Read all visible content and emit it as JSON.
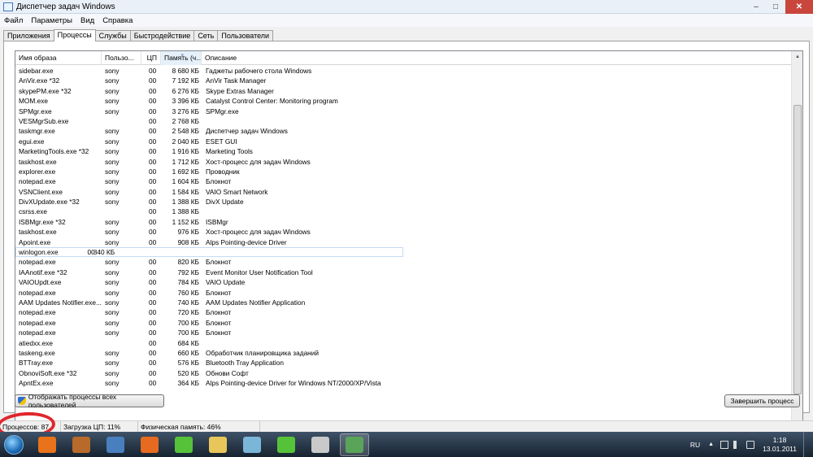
{
  "window": {
    "title": "Диспетчер задач Windows",
    "minimize": "–",
    "maximize": "□",
    "close": "✕"
  },
  "menu": [
    "Файл",
    "Параметры",
    "Вид",
    "Справка"
  ],
  "tabs": [
    {
      "label": "Приложения",
      "active": false
    },
    {
      "label": "Процессы",
      "active": true
    },
    {
      "label": "Службы",
      "active": false
    },
    {
      "label": "Быстродействие",
      "active": false
    },
    {
      "label": "Сеть",
      "active": false
    },
    {
      "label": "Пользователи",
      "active": false
    }
  ],
  "columns": [
    "Имя образа",
    "Пользо...",
    "ЦП",
    "Память (ч...",
    "Описание"
  ],
  "sorted_column_index": 3,
  "selected_row_index": 18,
  "processes": [
    [
      "sidebar.exe",
      "sony",
      "00",
      "8 680 КБ",
      "Гаджеты рабочего стола Windows"
    ],
    [
      "AnVir.exe *32",
      "sony",
      "00",
      "7 192 КБ",
      "AnVir Task Manager"
    ],
    [
      "skypePM.exe *32",
      "sony",
      "00",
      "6 276 КБ",
      "Skype Extras Manager"
    ],
    [
      "MOM.exe",
      "sony",
      "00",
      "3 396 КБ",
      "Catalyst Control Center: Monitoring program"
    ],
    [
      "SPMgr.exe",
      "sony",
      "00",
      "3 276 КБ",
      "SPMgr.exe"
    ],
    [
      "VESMgrSub.exe",
      "",
      "00",
      "2 768 КБ",
      ""
    ],
    [
      "taskmgr.exe",
      "sony",
      "00",
      "2 548 КБ",
      "Диспетчер задач Windows"
    ],
    [
      "egui.exe",
      "sony",
      "00",
      "2 040 КБ",
      "ESET GUI"
    ],
    [
      "MarketingTools.exe *32",
      "sony",
      "00",
      "1 916 КБ",
      "Marketing Tools"
    ],
    [
      "taskhost.exe",
      "sony",
      "00",
      "1 712 КБ",
      "Хост-процесс для задач Windows"
    ],
    [
      "explorer.exe",
      "sony",
      "00",
      "1 692 КБ",
      "Проводник"
    ],
    [
      "notepad.exe",
      "sony",
      "00",
      "1 604 КБ",
      "Блокнот"
    ],
    [
      "VSNClient.exe",
      "sony",
      "00",
      "1 584 КБ",
      "VAIO Smart Network"
    ],
    [
      "DivXUpdate.exe *32",
      "sony",
      "00",
      "1 388 КБ",
      "DivX Update"
    ],
    [
      "csrss.exe",
      "",
      "00",
      "1 388 КБ",
      ""
    ],
    [
      "ISBMgr.exe *32",
      "sony",
      "00",
      "1 152 КБ",
      "ISBMgr"
    ],
    [
      "taskhost.exe",
      "sony",
      "00",
      "976 КБ",
      "Хост-процесс для задач Windows"
    ],
    [
      "Apoint.exe",
      "sony",
      "00",
      "908 КБ",
      "Alps Pointing-device Driver"
    ],
    [
      "winlogon.exe",
      "",
      "00",
      "840 КБ",
      ""
    ],
    [
      "notepad.exe",
      "sony",
      "00",
      "820 КБ",
      "Блокнот"
    ],
    [
      "IAAnotif.exe *32",
      "sony",
      "00",
      "792 КБ",
      "Event Monitor User Notification Tool"
    ],
    [
      "VAIOUpdt.exe",
      "sony",
      "00",
      "784 КБ",
      "VAIO Update"
    ],
    [
      "notepad.exe",
      "sony",
      "00",
      "760 КБ",
      "Блокнот"
    ],
    [
      "AAM Updates Notifier.exe...",
      "sony",
      "00",
      "740 КБ",
      "AAM Updates Notifier Application"
    ],
    [
      "notepad.exe",
      "sony",
      "00",
      "720 КБ",
      "Блокнот"
    ],
    [
      "notepad.exe",
      "sony",
      "00",
      "700 КБ",
      "Блокнот"
    ],
    [
      "notepad.exe",
      "sony",
      "00",
      "700 КБ",
      "Блокнот"
    ],
    [
      "atiedxx.exe",
      "",
      "00",
      "684 КБ",
      ""
    ],
    [
      "taskeng.exe",
      "sony",
      "00",
      "660 КБ",
      "Обработчик планировщика заданий"
    ],
    [
      "BTTray.exe",
      "sony",
      "00",
      "576 КБ",
      "Bluetooth Tray Application"
    ],
    [
      "ObnoviSoft.exe *32",
      "sony",
      "00",
      "520 КБ",
      "Обнови Софт"
    ],
    [
      "ApntEx.exe",
      "sony",
      "00",
      "364 КБ",
      "Alps Pointing-device Driver for Windows NT/2000/XP/Vista"
    ]
  ],
  "buttons": {
    "show_all": "Отображать процессы всех пользователей",
    "end_process": "Завершить процесс"
  },
  "status": {
    "processes": "Процессов: 87",
    "cpu": "Загрузка ЦП: 11%",
    "memory": "Физическая память: 46%"
  },
  "tray": {
    "lang": "RU",
    "time": "1:18",
    "date": "13.01.2011"
  },
  "taskbar_icons": [
    {
      "name": "media-player",
      "color": "#e8731a",
      "active": false
    },
    {
      "name": "arrow-tool",
      "color": "#b86a2a",
      "active": false
    },
    {
      "name": "network-app",
      "color": "#4a7fbf",
      "active": false
    },
    {
      "name": "firefox",
      "color": "#e66a1f",
      "active": false
    },
    {
      "name": "icq",
      "color": "#56c23a",
      "active": false
    },
    {
      "name": "explorer-folder",
      "color": "#e9c65a",
      "active": false
    },
    {
      "name": "paint-app",
      "color": "#7bb6d8",
      "active": false
    },
    {
      "name": "icq-2",
      "color": "#56c23a",
      "active": false
    },
    {
      "name": "disk-tool",
      "color": "#c9c9c9",
      "active": false
    },
    {
      "name": "task-manager",
      "color": "#5aa45a",
      "active": true
    }
  ]
}
